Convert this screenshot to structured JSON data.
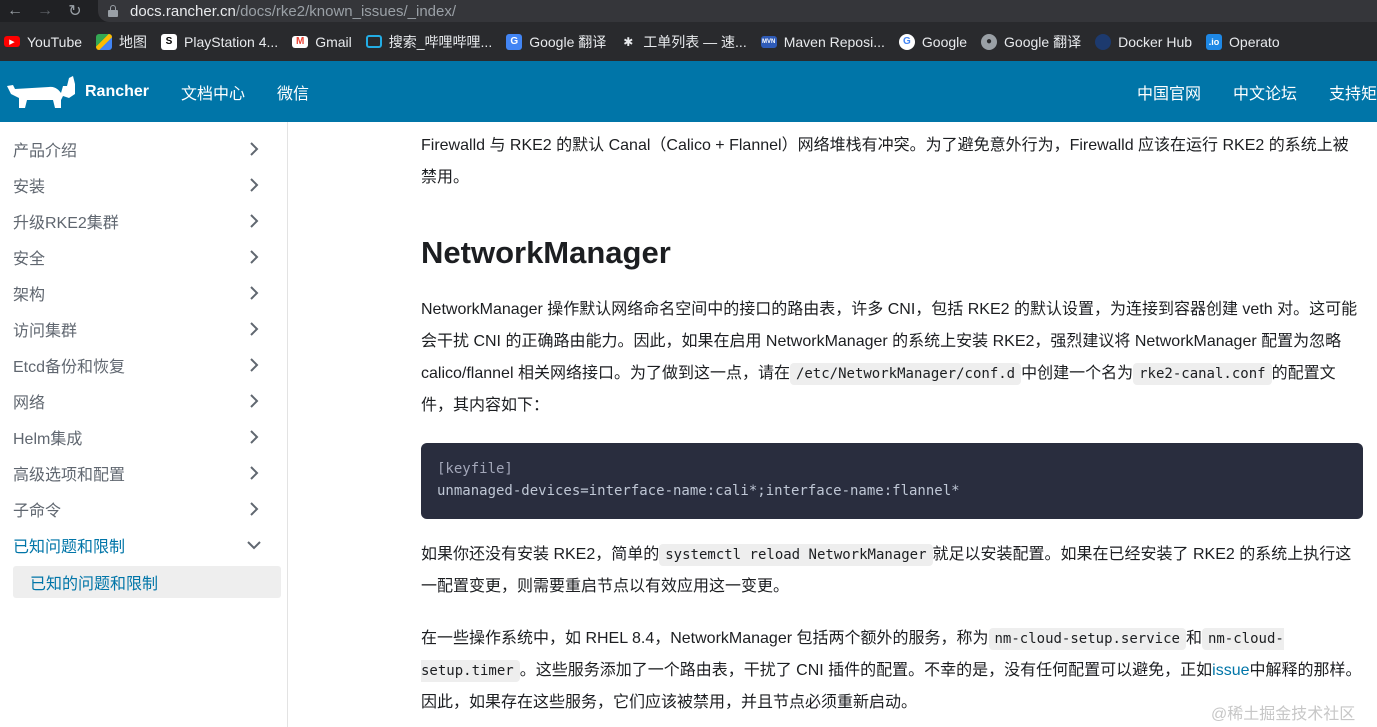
{
  "browser": {
    "url_host": "docs.rancher.cn",
    "url_path": "/docs/rke2/known_issues/_index/"
  },
  "bookmarks": [
    {
      "label": "YouTube",
      "icon": "youtube-icon",
      "color": "#ff0000"
    },
    {
      "label": "地图",
      "icon": "maps-icon",
      "color": "#34a853"
    },
    {
      "label": "PlayStation 4...",
      "icon": "playstation-icon",
      "color": "#ffffff"
    },
    {
      "label": "Gmail",
      "icon": "gmail-icon",
      "color": "#ea4335"
    },
    {
      "label": "搜索_哔哩哔哩...",
      "icon": "bilibili-icon",
      "color": "#23ade5"
    },
    {
      "label": "Google 翻译",
      "icon": "translate-icon",
      "color": "#4285f4"
    },
    {
      "label": "工单列表 — 速...",
      "icon": "ticket-icon",
      "color": "#e8eaed"
    },
    {
      "label": "Maven Reposi...",
      "icon": "maven-icon",
      "color": "#2f5bb7"
    },
    {
      "label": "Google",
      "icon": "google-icon",
      "color": "#4285f4"
    },
    {
      "label": "Google 翻译",
      "icon": "globe-icon",
      "color": "#9aa0a6"
    },
    {
      "label": "Docker Hub",
      "icon": "docker-icon",
      "color": "#1d63ed"
    },
    {
      "label": "Operato",
      "icon": "operatorhub-icon",
      "color": "#1e88e5"
    }
  ],
  "header": {
    "brand": "Rancher",
    "nav_left": [
      "文档中心",
      "微信"
    ],
    "nav_right": [
      "中国官网",
      "中文论坛",
      "支持矩"
    ],
    "bg_color": "#0075a8"
  },
  "sidebar": {
    "items": [
      {
        "label": "产品介绍"
      },
      {
        "label": "安装"
      },
      {
        "label": "升级RKE2集群"
      },
      {
        "label": "安全"
      },
      {
        "label": "架构"
      },
      {
        "label": "访问集群"
      },
      {
        "label": "Etcd备份和恢复"
      },
      {
        "label": "网络"
      },
      {
        "label": "Helm集成"
      },
      {
        "label": "高级选项和配置"
      },
      {
        "label": "子命令"
      },
      {
        "label": "已知问题和限制",
        "expanded": true
      }
    ],
    "sub_item": "已知的问题和限制"
  },
  "content": {
    "p1": "Firewalld 与 RKE2 的默认 Canal（Calico + Flannel）网络堆栈有冲突。为了避免意外行为，Firewalld 应该在运行 RKE2 的系统上被禁用。",
    "heading": "NetworkManager",
    "p2_a": "NetworkManager 操作默认网络命名空间中的接口的路由表，许多 CNI，包括 RKE2 的默认设置，为连接到容器创建 veth 对。这可能会干扰 CNI 的正确路由能力。因此，如果在启用 NetworkManager 的系统上安装 RKE2，强烈建议将 NetworkManager 配置为忽略 calico/flannel 相关网络接口。为了做到这一点，请在",
    "p2_code1": "/etc/NetworkManager/conf.d",
    "p2_b": "中创建一个名为",
    "p2_code2": "rke2-canal.conf",
    "p2_c": "的配置文件，其内容如下：",
    "code_line1": "[keyfile]",
    "code_line2": "unmanaged-devices=interface-name:cali*;interface-name:flannel*",
    "p3_a": "如果你还没有安装 RKE2，简单的",
    "p3_code": "systemctl reload NetworkManager",
    "p3_b": "就足以安装配置。如果在已经安装了 RKE2 的系统上执行这一配置变更，则需要重启节点以有效应用这一变更。",
    "p4_a": "在一些操作系统中，如 RHEL 8.4，NetworkManager 包括两个额外的服务，称为",
    "p4_code1": "nm-cloud-setup.service",
    "p4_b": "和",
    "p4_code2": "nm-cloud-setup.timer",
    "p4_c": "。这些服务添加了一个路由表，干扰了 CNI 插件的配置。不幸的是，没有任何配置可以避免，正如",
    "p4_link": "issue",
    "p4_d": "中解释的那样。因此，如果存在这些服务，它们应该被禁用，并且节点必须重新启动。"
  },
  "watermark": "@稀土掘金技术社区"
}
